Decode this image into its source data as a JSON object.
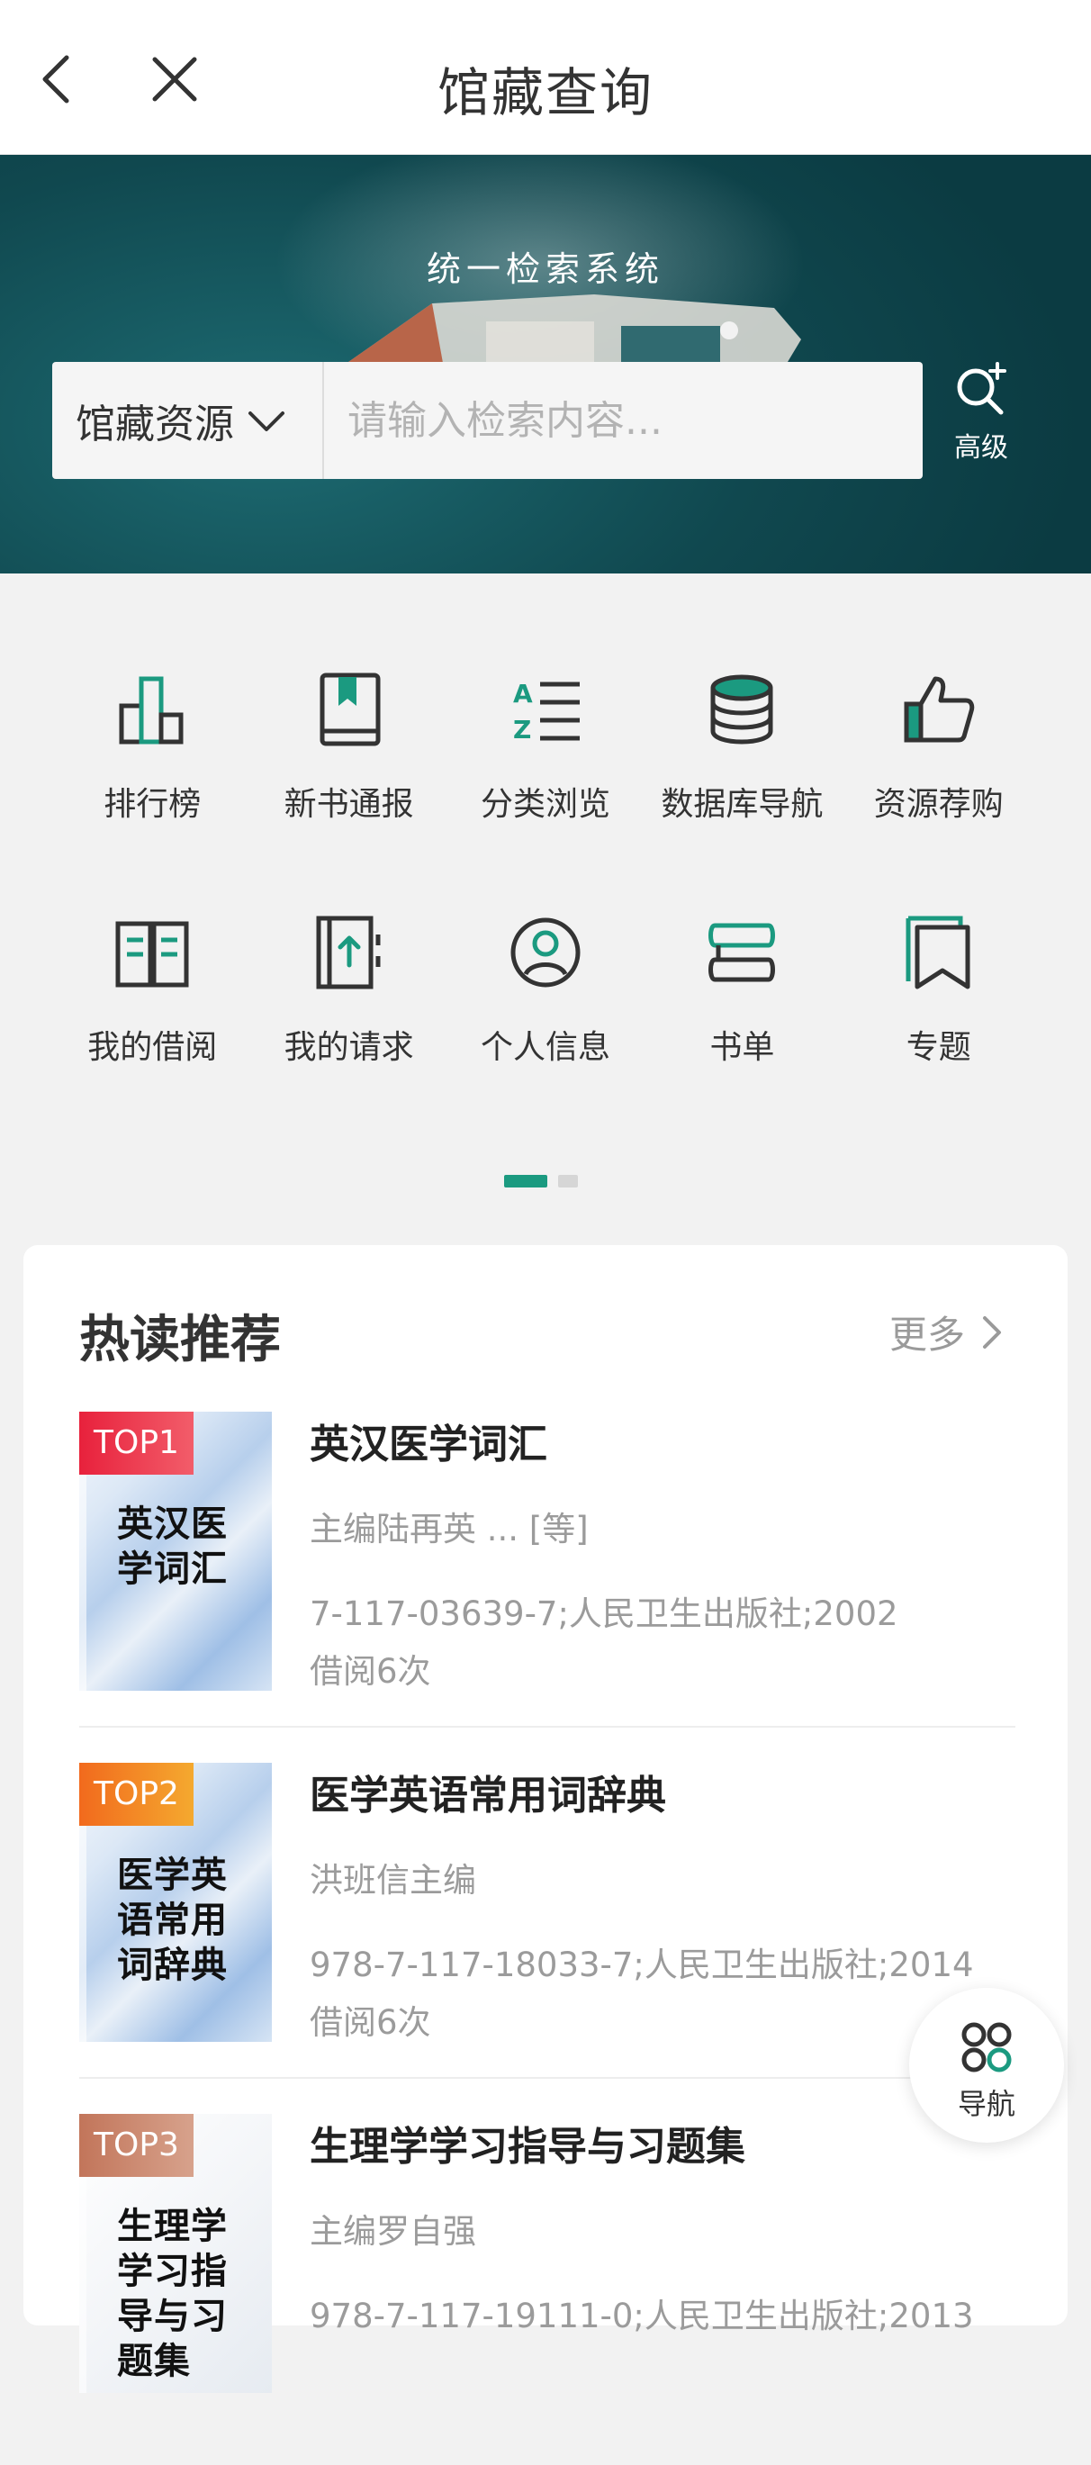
{
  "header": {
    "title": "馆藏查询"
  },
  "banner": {
    "subtitle": "统一检索系统",
    "scope_label": "馆藏资源",
    "search_placeholder": "请输入检索内容...",
    "advanced_label": "高级"
  },
  "menu": {
    "row1": [
      {
        "label": "排行榜",
        "icon": "ranking-chart-icon"
      },
      {
        "label": "新书通报",
        "icon": "book-icon"
      },
      {
        "label": "分类浏览",
        "icon": "az-list-icon"
      },
      {
        "label": "数据库导航",
        "icon": "database-icon"
      },
      {
        "label": "资源荐购",
        "icon": "thumbs-up-icon"
      }
    ],
    "row2": [
      {
        "label": "我的借阅",
        "icon": "open-book-icon"
      },
      {
        "label": "我的请求",
        "icon": "request-icon"
      },
      {
        "label": "个人信息",
        "icon": "user-circle-icon"
      },
      {
        "label": "书单",
        "icon": "booklist-icon"
      },
      {
        "label": "专题",
        "icon": "bookmark-icon"
      }
    ],
    "page_indicator": {
      "current": 1,
      "total": 2
    }
  },
  "hot": {
    "title": "热读推荐",
    "more_label": "更多",
    "books": [
      {
        "rank": "TOP1",
        "cover_title": "英汉医学词汇",
        "title": "英汉医学词汇",
        "author": "主编陆再英 ... [等]",
        "publication": "7-117-03639-7;人民卫生出版社;2002",
        "borrow": "借阅6次"
      },
      {
        "rank": "TOP2",
        "cover_title": "医学英语常用词辞典",
        "title": "医学英语常用词辞典",
        "author": "洪班信主编",
        "publication": "978-7-117-18033-7;人民卫生出版社;2014",
        "borrow": "借阅6次"
      },
      {
        "rank": "TOP3",
        "cover_title": "生理学学习指导与习题集",
        "title": "生理学学习指导与习题集",
        "author": "主编罗自强",
        "publication": "978-7-117-19111-0;人民卫生出版社;2013",
        "borrow": ""
      }
    ]
  },
  "fab": {
    "label": "导航"
  },
  "colors": {
    "accent": "#1b9a80",
    "top1": "#e8213c",
    "top2": "#f26a1d",
    "top3": "#c2755a"
  }
}
